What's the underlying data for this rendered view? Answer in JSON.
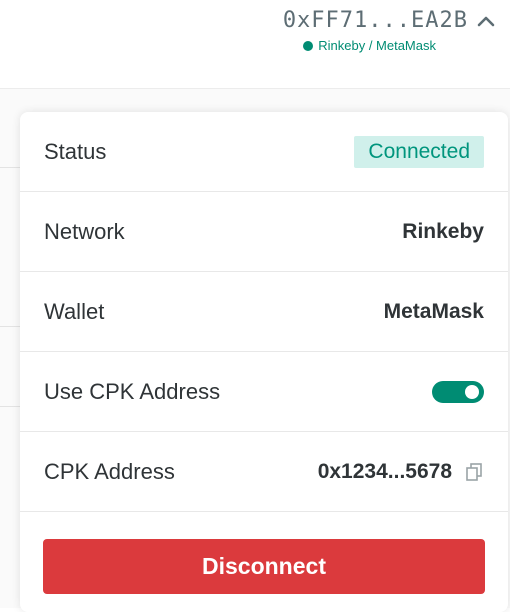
{
  "account": {
    "address": "0xFF71...EA2B",
    "network_provider": "Rinkeby / MetaMask",
    "status_color": "#008c73",
    "expand_icon": "chevron-up-icon"
  },
  "details": {
    "status_label": "Status",
    "status_value": "Connected",
    "network_label": "Network",
    "network_value": "Rinkeby",
    "wallet_label": "Wallet",
    "wallet_value": "MetaMask",
    "use_cpk_label": "Use CPK Address",
    "use_cpk_enabled": true,
    "cpk_label": "CPK Address",
    "cpk_value": "0x1234...5678",
    "copy_icon": "copy-icon"
  },
  "actions": {
    "disconnect_label": "Disconnect",
    "disconnect_color": "#db3a3d"
  }
}
